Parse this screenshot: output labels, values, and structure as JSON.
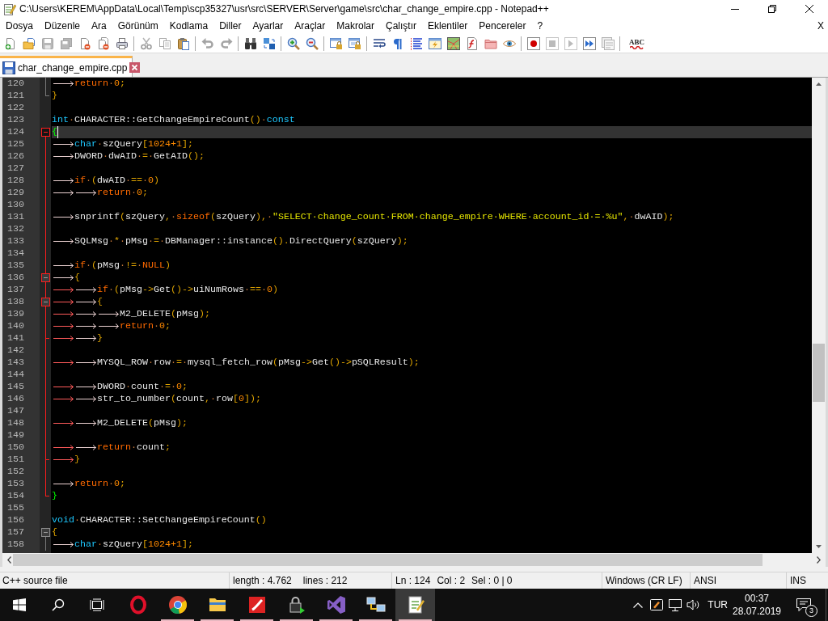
{
  "window": {
    "title": "C:\\Users\\KEREM\\AppData\\Local\\Temp\\scp35327\\usr\\src\\SERVER\\Server\\game\\src\\char_change_empire.cpp - Notepad++"
  },
  "menu": {
    "items": [
      "Dosya",
      "Düzenle",
      "Ara",
      "Görünüm",
      "Kodlama",
      "Diller",
      "Ayarlar",
      "Araçlar",
      "Makrolar",
      "Çalıştır",
      "Eklentiler",
      "Pencereler",
      "?"
    ],
    "close_label": "X"
  },
  "toolbar": {
    "buttons": [
      {
        "disabled": false
      },
      {
        "disabled": false
      },
      {
        "disabled": true
      },
      {
        "disabled": true
      },
      {
        "disabled": false
      },
      {
        "disabled": false
      },
      {
        "disabled": false
      },
      {
        "disabled": true
      },
      {
        "disabled": true
      },
      {
        "disabled": false
      },
      {
        "disabled": true
      },
      {
        "disabled": true
      },
      {
        "disabled": false
      },
      {
        "disabled": false
      },
      {
        "disabled": false
      },
      {
        "disabled": false
      },
      {
        "disabled": false
      },
      {
        "disabled": false
      },
      {
        "disabled": false
      },
      {
        "disabled": false
      },
      {
        "disabled": false
      },
      {
        "disabled": false
      },
      {
        "disabled": false
      },
      {
        "disabled": false
      },
      {
        "disabled": false
      },
      {
        "disabled": false
      },
      {
        "disabled": false
      },
      {
        "disabled": true
      },
      {
        "disabled": true
      },
      {
        "disabled": false
      },
      {
        "disabled": true
      }
    ],
    "text_button_label": "ABC"
  },
  "tabs": [
    {
      "label": "char_change_empire.cpp",
      "selected": true,
      "modified": false
    }
  ],
  "editor": {
    "lines": [
      {
        "number": "120",
        "current": false,
        "fold": {
          "kind": "body"
        },
        "tabs": [
          {
            "highlighted": false
          }
        ],
        "tokens": [
          {
            "kind": "keyword",
            "text": "return"
          },
          {
            "kind": "space",
            "text": "·"
          },
          {
            "kind": "number",
            "text": "0"
          },
          {
            "kind": "operator",
            "text": ";"
          }
        ]
      },
      {
        "number": "121",
        "current": false,
        "fold": {
          "kind": "tail"
        },
        "tokens": [
          {
            "kind": "operator",
            "text": "}"
          }
        ]
      },
      {
        "number": "122",
        "current": false
      },
      {
        "number": "123",
        "current": false,
        "tokens": [
          {
            "kind": "type",
            "text": "int"
          },
          {
            "kind": "space",
            "text": "·"
          },
          {
            "kind": "name",
            "text": "CHARACTER::GetChangeEmpireCount"
          },
          {
            "kind": "operator",
            "text": "()"
          },
          {
            "kind": "space",
            "text": "·"
          },
          {
            "kind": "type",
            "text": "const"
          }
        ]
      },
      {
        "number": "124",
        "current": true,
        "fold": {
          "kind": "head",
          "active": true
        },
        "tokens": [
          {
            "kind": "match",
            "text": "{"
          }
        ]
      },
      {
        "number": "125",
        "current": false,
        "fold": {
          "kind": "body"
        },
        "tabs": [
          {
            "highlighted": false
          }
        ],
        "tokens": [
          {
            "kind": "type",
            "text": "char"
          },
          {
            "kind": "space",
            "text": "·"
          },
          {
            "kind": "name",
            "text": "szQuery"
          },
          {
            "kind": "operator",
            "text": "["
          },
          {
            "kind": "number",
            "text": "1024+1"
          },
          {
            "kind": "operator",
            "text": "];"
          }
        ]
      },
      {
        "number": "126",
        "current": false,
        "fold": {
          "kind": "body"
        },
        "tabs": [
          {
            "highlighted": false
          }
        ],
        "tokens": [
          {
            "kind": "name",
            "text": "DWORD"
          },
          {
            "kind": "space",
            "text": "·"
          },
          {
            "kind": "name",
            "text": "dwAID"
          },
          {
            "kind": "space",
            "text": "·"
          },
          {
            "kind": "operator",
            "text": "="
          },
          {
            "kind": "space",
            "text": "·"
          },
          {
            "kind": "name",
            "text": "GetAID"
          },
          {
            "kind": "operator",
            "text": "();"
          }
        ]
      },
      {
        "number": "127",
        "current": false,
        "fold": {
          "kind": "body"
        }
      },
      {
        "number": "128",
        "current": false,
        "fold": {
          "kind": "body"
        },
        "tabs": [
          {
            "highlighted": false
          }
        ],
        "tokens": [
          {
            "kind": "keyword",
            "text": "if"
          },
          {
            "kind": "space",
            "text": "·"
          },
          {
            "kind": "operator",
            "text": "("
          },
          {
            "kind": "name",
            "text": "dwAID"
          },
          {
            "kind": "space",
            "text": "·"
          },
          {
            "kind": "operator",
            "text": "=="
          },
          {
            "kind": "space",
            "text": "·"
          },
          {
            "kind": "number",
            "text": "0"
          },
          {
            "kind": "operator",
            "text": ")"
          }
        ]
      },
      {
        "number": "129",
        "current": false,
        "fold": {
          "kind": "body"
        },
        "tabs": [
          {
            "highlighted": false
          },
          {
            "highlighted": false
          }
        ],
        "tokens": [
          {
            "kind": "keyword",
            "text": "return"
          },
          {
            "kind": "space",
            "text": "·"
          },
          {
            "kind": "number",
            "text": "0"
          },
          {
            "kind": "operator",
            "text": ";"
          }
        ]
      },
      {
        "number": "130",
        "current": false,
        "fold": {
          "kind": "body"
        }
      },
      {
        "number": "131",
        "current": false,
        "fold": {
          "kind": "body"
        },
        "tabs": [
          {
            "highlighted": false
          }
        ],
        "tokens": [
          {
            "kind": "name",
            "text": "snprintf"
          },
          {
            "kind": "operator",
            "text": "("
          },
          {
            "kind": "name",
            "text": "szQuery"
          },
          {
            "kind": "operator",
            "text": ","
          },
          {
            "kind": "space",
            "text": "·"
          },
          {
            "kind": "keyword",
            "text": "sizeof"
          },
          {
            "kind": "operator",
            "text": "("
          },
          {
            "kind": "name",
            "text": "szQuery"
          },
          {
            "kind": "operator",
            "text": "),"
          },
          {
            "kind": "space",
            "text": "·"
          },
          {
            "kind": "string",
            "text": "\"SELECT·change_count·FROM·change_empire·WHERE·account_id·=·%u\""
          },
          {
            "kind": "operator",
            "text": ","
          },
          {
            "kind": "space",
            "text": "·"
          },
          {
            "kind": "name",
            "text": "dwAID"
          },
          {
            "kind": "operator",
            "text": ");"
          }
        ]
      },
      {
        "number": "132",
        "current": false,
        "fold": {
          "kind": "body"
        }
      },
      {
        "number": "133",
        "current": false,
        "fold": {
          "kind": "body"
        },
        "tabs": [
          {
            "highlighted": false
          }
        ],
        "tokens": [
          {
            "kind": "name",
            "text": "SQLMsg"
          },
          {
            "kind": "space",
            "text": "·"
          },
          {
            "kind": "operator",
            "text": "*"
          },
          {
            "kind": "space",
            "text": "·"
          },
          {
            "kind": "name",
            "text": "pMsg"
          },
          {
            "kind": "space",
            "text": "·"
          },
          {
            "kind": "operator",
            "text": "="
          },
          {
            "kind": "space",
            "text": "·"
          },
          {
            "kind": "name",
            "text": "DBManager::instance"
          },
          {
            "kind": "operator",
            "text": "()."
          },
          {
            "kind": "name",
            "text": "DirectQuery"
          },
          {
            "kind": "operator",
            "text": "("
          },
          {
            "kind": "name",
            "text": "szQuery"
          },
          {
            "kind": "operator",
            "text": ");"
          }
        ]
      },
      {
        "number": "134",
        "current": false,
        "fold": {
          "kind": "body"
        }
      },
      {
        "number": "135",
        "current": false,
        "fold": {
          "kind": "body"
        },
        "tabs": [
          {
            "highlighted": false
          }
        ],
        "tokens": [
          {
            "kind": "keyword",
            "text": "if"
          },
          {
            "kind": "space",
            "text": "·"
          },
          {
            "kind": "operator",
            "text": "("
          },
          {
            "kind": "name",
            "text": "pMsg"
          },
          {
            "kind": "space",
            "text": "·"
          },
          {
            "kind": "operator",
            "text": "!="
          },
          {
            "kind": "space",
            "text": "·"
          },
          {
            "kind": "keyword",
            "text": "NULL"
          },
          {
            "kind": "operator",
            "text": ")"
          }
        ]
      },
      {
        "number": "136",
        "current": false,
        "fold": {
          "kind": "head",
          "active": true
        },
        "tabs": [
          {
            "highlighted": false
          }
        ],
        "tokens": [
          {
            "kind": "operator",
            "text": "{"
          }
        ]
      },
      {
        "number": "137",
        "current": false,
        "fold": {
          "kind": "body"
        },
        "tabs": [
          {
            "highlighted": true
          },
          {
            "highlighted": false
          }
        ],
        "tokens": [
          {
            "kind": "keyword",
            "text": "if"
          },
          {
            "kind": "space",
            "text": "·"
          },
          {
            "kind": "operator",
            "text": "("
          },
          {
            "kind": "name",
            "text": "pMsg"
          },
          {
            "kind": "operator",
            "text": "->"
          },
          {
            "kind": "name",
            "text": "Get"
          },
          {
            "kind": "operator",
            "text": "()->"
          },
          {
            "kind": "name",
            "text": "uiNumRows"
          },
          {
            "kind": "space",
            "text": "·"
          },
          {
            "kind": "operator",
            "text": "=="
          },
          {
            "kind": "space",
            "text": "·"
          },
          {
            "kind": "number",
            "text": "0"
          },
          {
            "kind": "operator",
            "text": ")"
          }
        ]
      },
      {
        "number": "138",
        "current": false,
        "fold": {
          "kind": "head",
          "active": true
        },
        "tabs": [
          {
            "highlighted": true
          },
          {
            "highlighted": false
          }
        ],
        "tokens": [
          {
            "kind": "operator",
            "text": "{"
          }
        ]
      },
      {
        "number": "139",
        "current": false,
        "fold": {
          "kind": "body"
        },
        "tabs": [
          {
            "highlighted": true
          },
          {
            "highlighted": false
          },
          {
            "highlighted": false
          }
        ],
        "tokens": [
          {
            "kind": "name",
            "text": "M2_DELETE"
          },
          {
            "kind": "operator",
            "text": "("
          },
          {
            "kind": "name",
            "text": "pMsg"
          },
          {
            "kind": "operator",
            "text": ");"
          }
        ]
      },
      {
        "number": "140",
        "current": false,
        "fold": {
          "kind": "body"
        },
        "tabs": [
          {
            "highlighted": true
          },
          {
            "highlighted": false
          },
          {
            "highlighted": false
          }
        ],
        "tokens": [
          {
            "kind": "keyword",
            "text": "return"
          },
          {
            "kind": "space",
            "text": "·"
          },
          {
            "kind": "number",
            "text": "0"
          },
          {
            "kind": "operator",
            "text": ";"
          }
        ]
      },
      {
        "number": "141",
        "current": false,
        "fold": {
          "kind": "tail"
        },
        "tabs": [
          {
            "highlighted": true
          },
          {
            "highlighted": false
          }
        ],
        "tokens": [
          {
            "kind": "operator",
            "text": "}"
          }
        ]
      },
      {
        "number": "142",
        "current": false,
        "fold": {
          "kind": "body"
        }
      },
      {
        "number": "143",
        "current": false,
        "fold": {
          "kind": "body"
        },
        "tabs": [
          {
            "highlighted": true
          },
          {
            "highlighted": false
          }
        ],
        "tokens": [
          {
            "kind": "name",
            "text": "MYSQL_ROW"
          },
          {
            "kind": "space",
            "text": "·"
          },
          {
            "kind": "name",
            "text": "row"
          },
          {
            "kind": "space",
            "text": "·"
          },
          {
            "kind": "operator",
            "text": "="
          },
          {
            "kind": "space",
            "text": "·"
          },
          {
            "kind": "name",
            "text": "mysql_fetch_row"
          },
          {
            "kind": "operator",
            "text": "("
          },
          {
            "kind": "name",
            "text": "pMsg"
          },
          {
            "kind": "operator",
            "text": "->"
          },
          {
            "kind": "name",
            "text": "Get"
          },
          {
            "kind": "operator",
            "text": "()->"
          },
          {
            "kind": "name",
            "text": "pSQLResult"
          },
          {
            "kind": "operator",
            "text": ");"
          }
        ]
      },
      {
        "number": "144",
        "current": false,
        "fold": {
          "kind": "body"
        }
      },
      {
        "number": "145",
        "current": false,
        "fold": {
          "kind": "body"
        },
        "tabs": [
          {
            "highlighted": true
          },
          {
            "highlighted": false
          }
        ],
        "tokens": [
          {
            "kind": "name",
            "text": "DWORD"
          },
          {
            "kind": "space",
            "text": "·"
          },
          {
            "kind": "name",
            "text": "count"
          },
          {
            "kind": "space",
            "text": "·"
          },
          {
            "kind": "operator",
            "text": "="
          },
          {
            "kind": "space",
            "text": "·"
          },
          {
            "kind": "number",
            "text": "0"
          },
          {
            "kind": "operator",
            "text": ";"
          }
        ]
      },
      {
        "number": "146",
        "current": false,
        "fold": {
          "kind": "body"
        },
        "tabs": [
          {
            "highlighted": true
          },
          {
            "highlighted": false
          }
        ],
        "tokens": [
          {
            "kind": "name",
            "text": "str_to_number"
          },
          {
            "kind": "operator",
            "text": "("
          },
          {
            "kind": "name",
            "text": "count"
          },
          {
            "kind": "operator",
            "text": ","
          },
          {
            "kind": "space",
            "text": "·"
          },
          {
            "kind": "name",
            "text": "row"
          },
          {
            "kind": "operator",
            "text": "["
          },
          {
            "kind": "number",
            "text": "0"
          },
          {
            "kind": "operator",
            "text": "]);"
          }
        ]
      },
      {
        "number": "147",
        "current": false,
        "fold": {
          "kind": "body"
        }
      },
      {
        "number": "148",
        "current": false,
        "fold": {
          "kind": "body"
        },
        "tabs": [
          {
            "highlighted": true
          },
          {
            "highlighted": false
          }
        ],
        "tokens": [
          {
            "kind": "name",
            "text": "M2_DELETE"
          },
          {
            "kind": "operator",
            "text": "("
          },
          {
            "kind": "name",
            "text": "pMsg"
          },
          {
            "kind": "operator",
            "text": ");"
          }
        ]
      },
      {
        "number": "149",
        "current": false,
        "fold": {
          "kind": "body"
        }
      },
      {
        "number": "150",
        "current": false,
        "fold": {
          "kind": "body"
        },
        "tabs": [
          {
            "highlighted": true
          },
          {
            "highlighted": false
          }
        ],
        "tokens": [
          {
            "kind": "keyword",
            "text": "return"
          },
          {
            "kind": "space",
            "text": "·"
          },
          {
            "kind": "name",
            "text": "count"
          },
          {
            "kind": "operator",
            "text": ";"
          }
        ]
      },
      {
        "number": "151",
        "current": false,
        "fold": {
          "kind": "tail"
        },
        "tabs": [
          {
            "highlighted": true
          }
        ],
        "tokens": [
          {
            "kind": "operator",
            "text": "}"
          }
        ]
      },
      {
        "number": "152",
        "current": false,
        "fold": {
          "kind": "body"
        }
      },
      {
        "number": "153",
        "current": false,
        "fold": {
          "kind": "body"
        },
        "tabs": [
          {
            "highlighted": false
          }
        ],
        "tokens": [
          {
            "kind": "keyword",
            "text": "return"
          },
          {
            "kind": "space",
            "text": "·"
          },
          {
            "kind": "number",
            "text": "0"
          },
          {
            "kind": "operator",
            "text": ";"
          }
        ]
      },
      {
        "number": "154",
        "current": false,
        "fold": {
          "kind": "tail"
        },
        "tokens": [
          {
            "kind": "match",
            "text": "}"
          }
        ]
      },
      {
        "number": "155",
        "current": false
      },
      {
        "number": "156",
        "current": false,
        "tokens": [
          {
            "kind": "type",
            "text": "void"
          },
          {
            "kind": "space",
            "text": "·"
          },
          {
            "kind": "name",
            "text": "CHARACTER::SetChangeEmpireCount"
          },
          {
            "kind": "operator",
            "text": "()"
          }
        ]
      },
      {
        "number": "157",
        "current": false,
        "fold": {
          "kind": "head",
          "active": false
        },
        "tokens": [
          {
            "kind": "operator",
            "text": "{"
          }
        ]
      },
      {
        "number": "158",
        "current": false,
        "fold": {
          "kind": "body"
        },
        "tabs": [
          {
            "highlighted": false
          }
        ],
        "tokens": [
          {
            "kind": "type",
            "text": "char"
          },
          {
            "kind": "space",
            "text": "·"
          },
          {
            "kind": "name",
            "text": "szQuery"
          },
          {
            "kind": "operator",
            "text": "["
          },
          {
            "kind": "number",
            "text": "1024+1"
          },
          {
            "kind": "operator",
            "text": "];"
          }
        ]
      }
    ]
  },
  "status_bar": {
    "file_type": "C++ source file",
    "length": "length : 4.762",
    "lines": "lines : 212",
    "line": "Ln : 124",
    "column": "Col : 2",
    "selection": "Sel : 0 | 0",
    "line_endings": "Windows (CR LF)",
    "encoding": "ANSI",
    "mode": "INS"
  },
  "taskbar": {
    "apps": [
      {
        "running": false,
        "selected": false
      },
      {
        "running": true,
        "selected": false
      },
      {
        "running": true,
        "selected": false
      },
      {
        "running": true,
        "selected": false
      },
      {
        "running": true,
        "selected": false
      },
      {
        "running": true,
        "selected": false
      },
      {
        "running": true,
        "selected": false
      },
      {
        "running": true,
        "selected": true
      }
    ],
    "language": "TUR",
    "time": "00:37",
    "date": "28.07.2019",
    "notifications": "3"
  }
}
